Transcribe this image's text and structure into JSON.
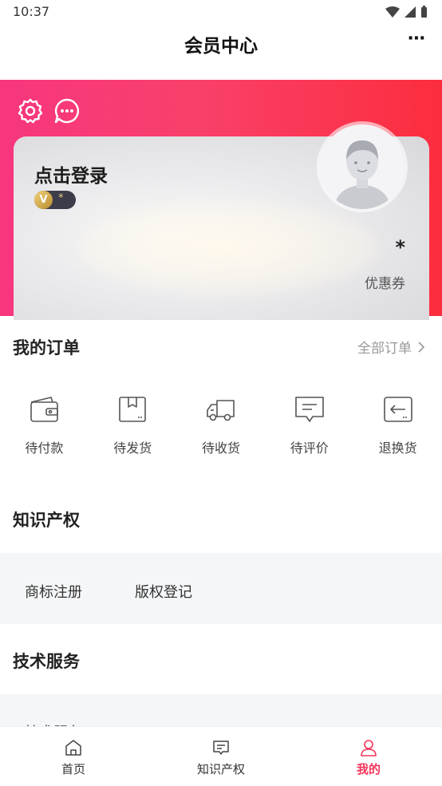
{
  "status_bar": {
    "time": "10:37"
  },
  "nav": {
    "title": "会员中心",
    "more": "⋯"
  },
  "header": {
    "login_text": "点击登录",
    "level_badge": {
      "coin": "V",
      "level": "*"
    },
    "coupon": {
      "value": "*",
      "label": "优惠券"
    },
    "colors": {
      "gradient_start": "#f7367f",
      "gradient_end": "#fc2d3d"
    }
  },
  "orders": {
    "title": "我的订单",
    "all_label": "全部订单",
    "items": [
      {
        "label": "待付款",
        "icon": "wallet-icon"
      },
      {
        "label": "待发货",
        "icon": "package-icon"
      },
      {
        "label": "待收货",
        "icon": "truck-icon"
      },
      {
        "label": "待评价",
        "icon": "comment-icon"
      },
      {
        "label": "退换货",
        "icon": "return-icon"
      }
    ]
  },
  "ip": {
    "title": "知识产权",
    "links": [
      "商标注册",
      "版权登记"
    ]
  },
  "tech": {
    "title": "技术服务",
    "links": [
      "技术服务"
    ]
  },
  "tabbar": {
    "items": [
      {
        "label": "首页",
        "icon": "home-icon"
      },
      {
        "label": "知识产权",
        "icon": "message-icon"
      },
      {
        "label": "我的",
        "icon": "person-icon",
        "active": true
      }
    ],
    "active_color": "#f4345a"
  }
}
